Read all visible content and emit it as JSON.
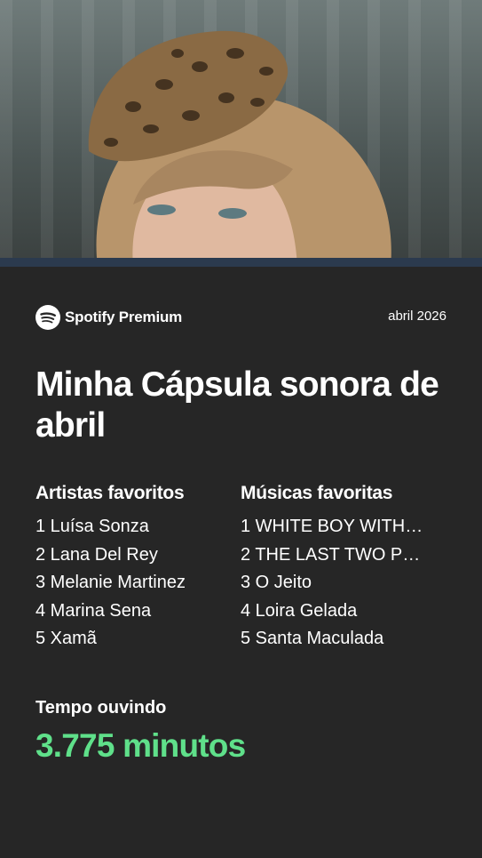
{
  "header": {
    "brand_label": "Spotify Premium",
    "date": "abril 2026"
  },
  "title": "Minha Cápsula sonora de abril",
  "top_artists": {
    "heading": "Artistas favoritos",
    "items": [
      "1 Luísa Sonza",
      "2 Lana Del Rey",
      "3 Melanie Martinez",
      "4 Marina Sena",
      "5 Xamã"
    ]
  },
  "top_songs": {
    "heading": "Músicas favoritas",
    "items": [
      "1 WHITE BOY WITH…",
      "2 THE LAST TWO P…",
      "3 O Jeito",
      "4 Loira Gelada",
      "5 Santa Maculada"
    ]
  },
  "listening_time": {
    "label": "Tempo ouvindo",
    "value": "3.775 minutos"
  },
  "colors": {
    "background": "#262626",
    "accent_green": "#5fe08a",
    "text": "#ffffff",
    "hero_strip": "#2b3a4e"
  },
  "icons": {
    "brand": "spotify-logo-icon"
  }
}
